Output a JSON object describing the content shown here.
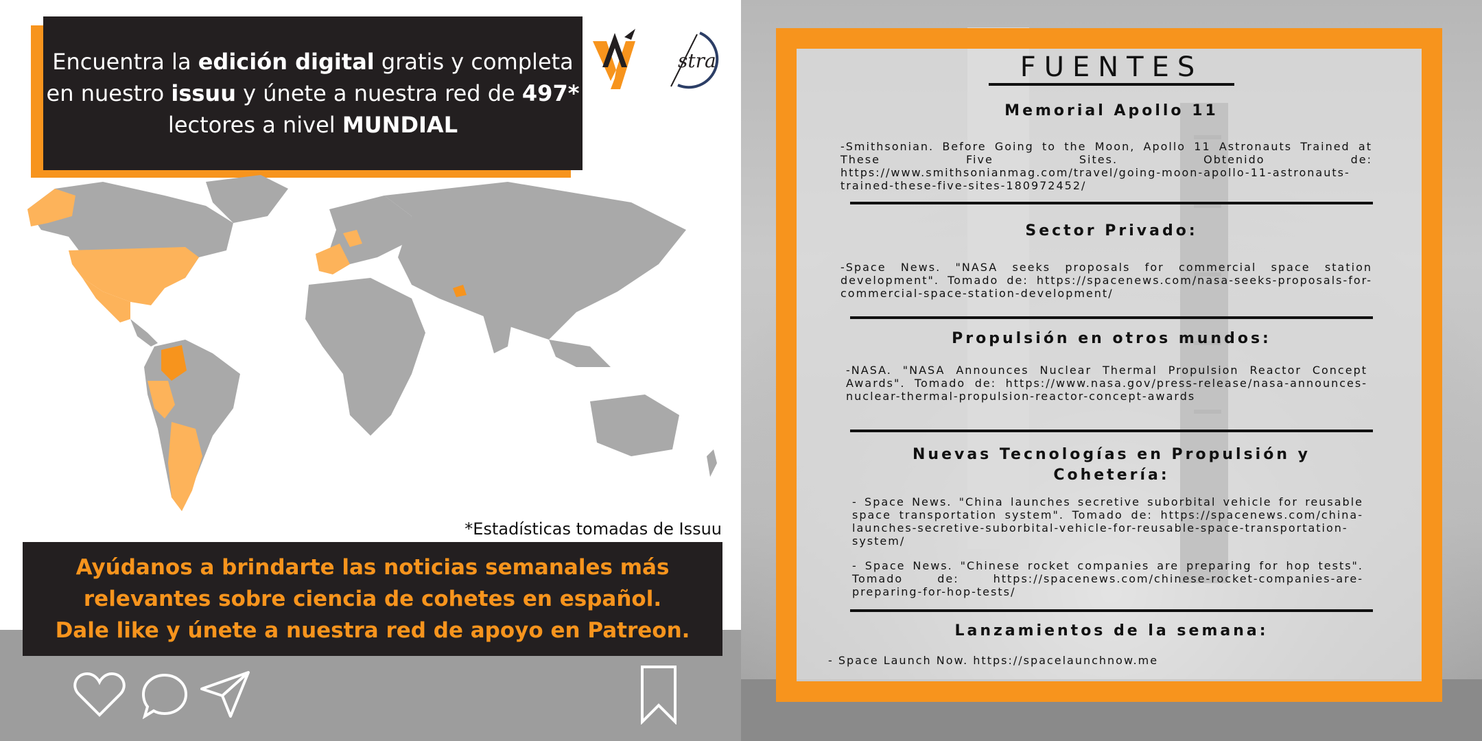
{
  "promo": {
    "line1_a": "Encuentra la ",
    "line1_b": "edición digital",
    "line1_c": "  gratis y completa",
    "line2_a": "en nuestro ",
    "line2_b": "issuu",
    "line2_c": " y únete a nuestra red de ",
    "line2_d": "497*",
    "line3_a": "lectores a nivel ",
    "line3_b": "MUNDIAL"
  },
  "logos": {
    "astra_text": "stra"
  },
  "stats_note": "*Estadísticas tomadas de Issuu",
  "cta": {
    "line1": "Ayúdanos a brindarte las noticias semanales más",
    "line2": "relevantes sobre ciencia de cohetes en español.",
    "line3": "Dale like y únete a nuestra red de apoyo en Patreon."
  },
  "icons": [
    "heart-icon",
    "comment-icon",
    "send-icon",
    "bookmark-icon"
  ],
  "colors": {
    "accent": "#f7941d",
    "dark": "#231f20",
    "map_gray": "#a9a9a9",
    "map_highlight": "#fdb35a"
  },
  "sources": {
    "title": "FUENTES",
    "sections": [
      {
        "heading": "Memorial Apollo 11",
        "body": "-Smithsonian. Before Going to the Moon, Apollo 11 Astronauts Trained at These Five Sites.  Obtenido de: https://www.smithsonianmag.com/travel/going-moon-apollo-11-astronauts-trained-these-five-sites-180972452/"
      },
      {
        "heading": "Sector Privado:",
        "body": "-Space News. \"NASA seeks proposals for commercial space station development\". Tomado de: https://spacenews.com/nasa-seeks-proposals-for-commercial-space-station-development/"
      },
      {
        "heading": "Propulsión en otros mundos:",
        "body": "-NASA. \"NASA Announces Nuclear Thermal Propulsion Reactor Concept Awards\". Tomado de: https://www.nasa.gov/press-release/nasa-announces-nuclear-thermal-propulsion-reactor-concept-awards"
      },
      {
        "heading": "Nuevas Tecnologías en Propulsión y Cohetería:",
        "body": "- Space News. \"China launches secretive suborbital vehicle for reusable space transportation system\". Tomado de: https://spacenews.com/china-launches-secretive-suborbital-vehicle-for-reusable-space-transportation-system/",
        "body2": "- Space News. \"Chinese rocket companies are preparing for hop tests\". Tomado de: https://spacenews.com/chinese-rocket-companies-are-preparing-for-hop-tests/"
      },
      {
        "heading": "Lanzamientos de la semana:",
        "body": "- Space Launch Now. https://spacelaunchnow.me"
      }
    ]
  }
}
